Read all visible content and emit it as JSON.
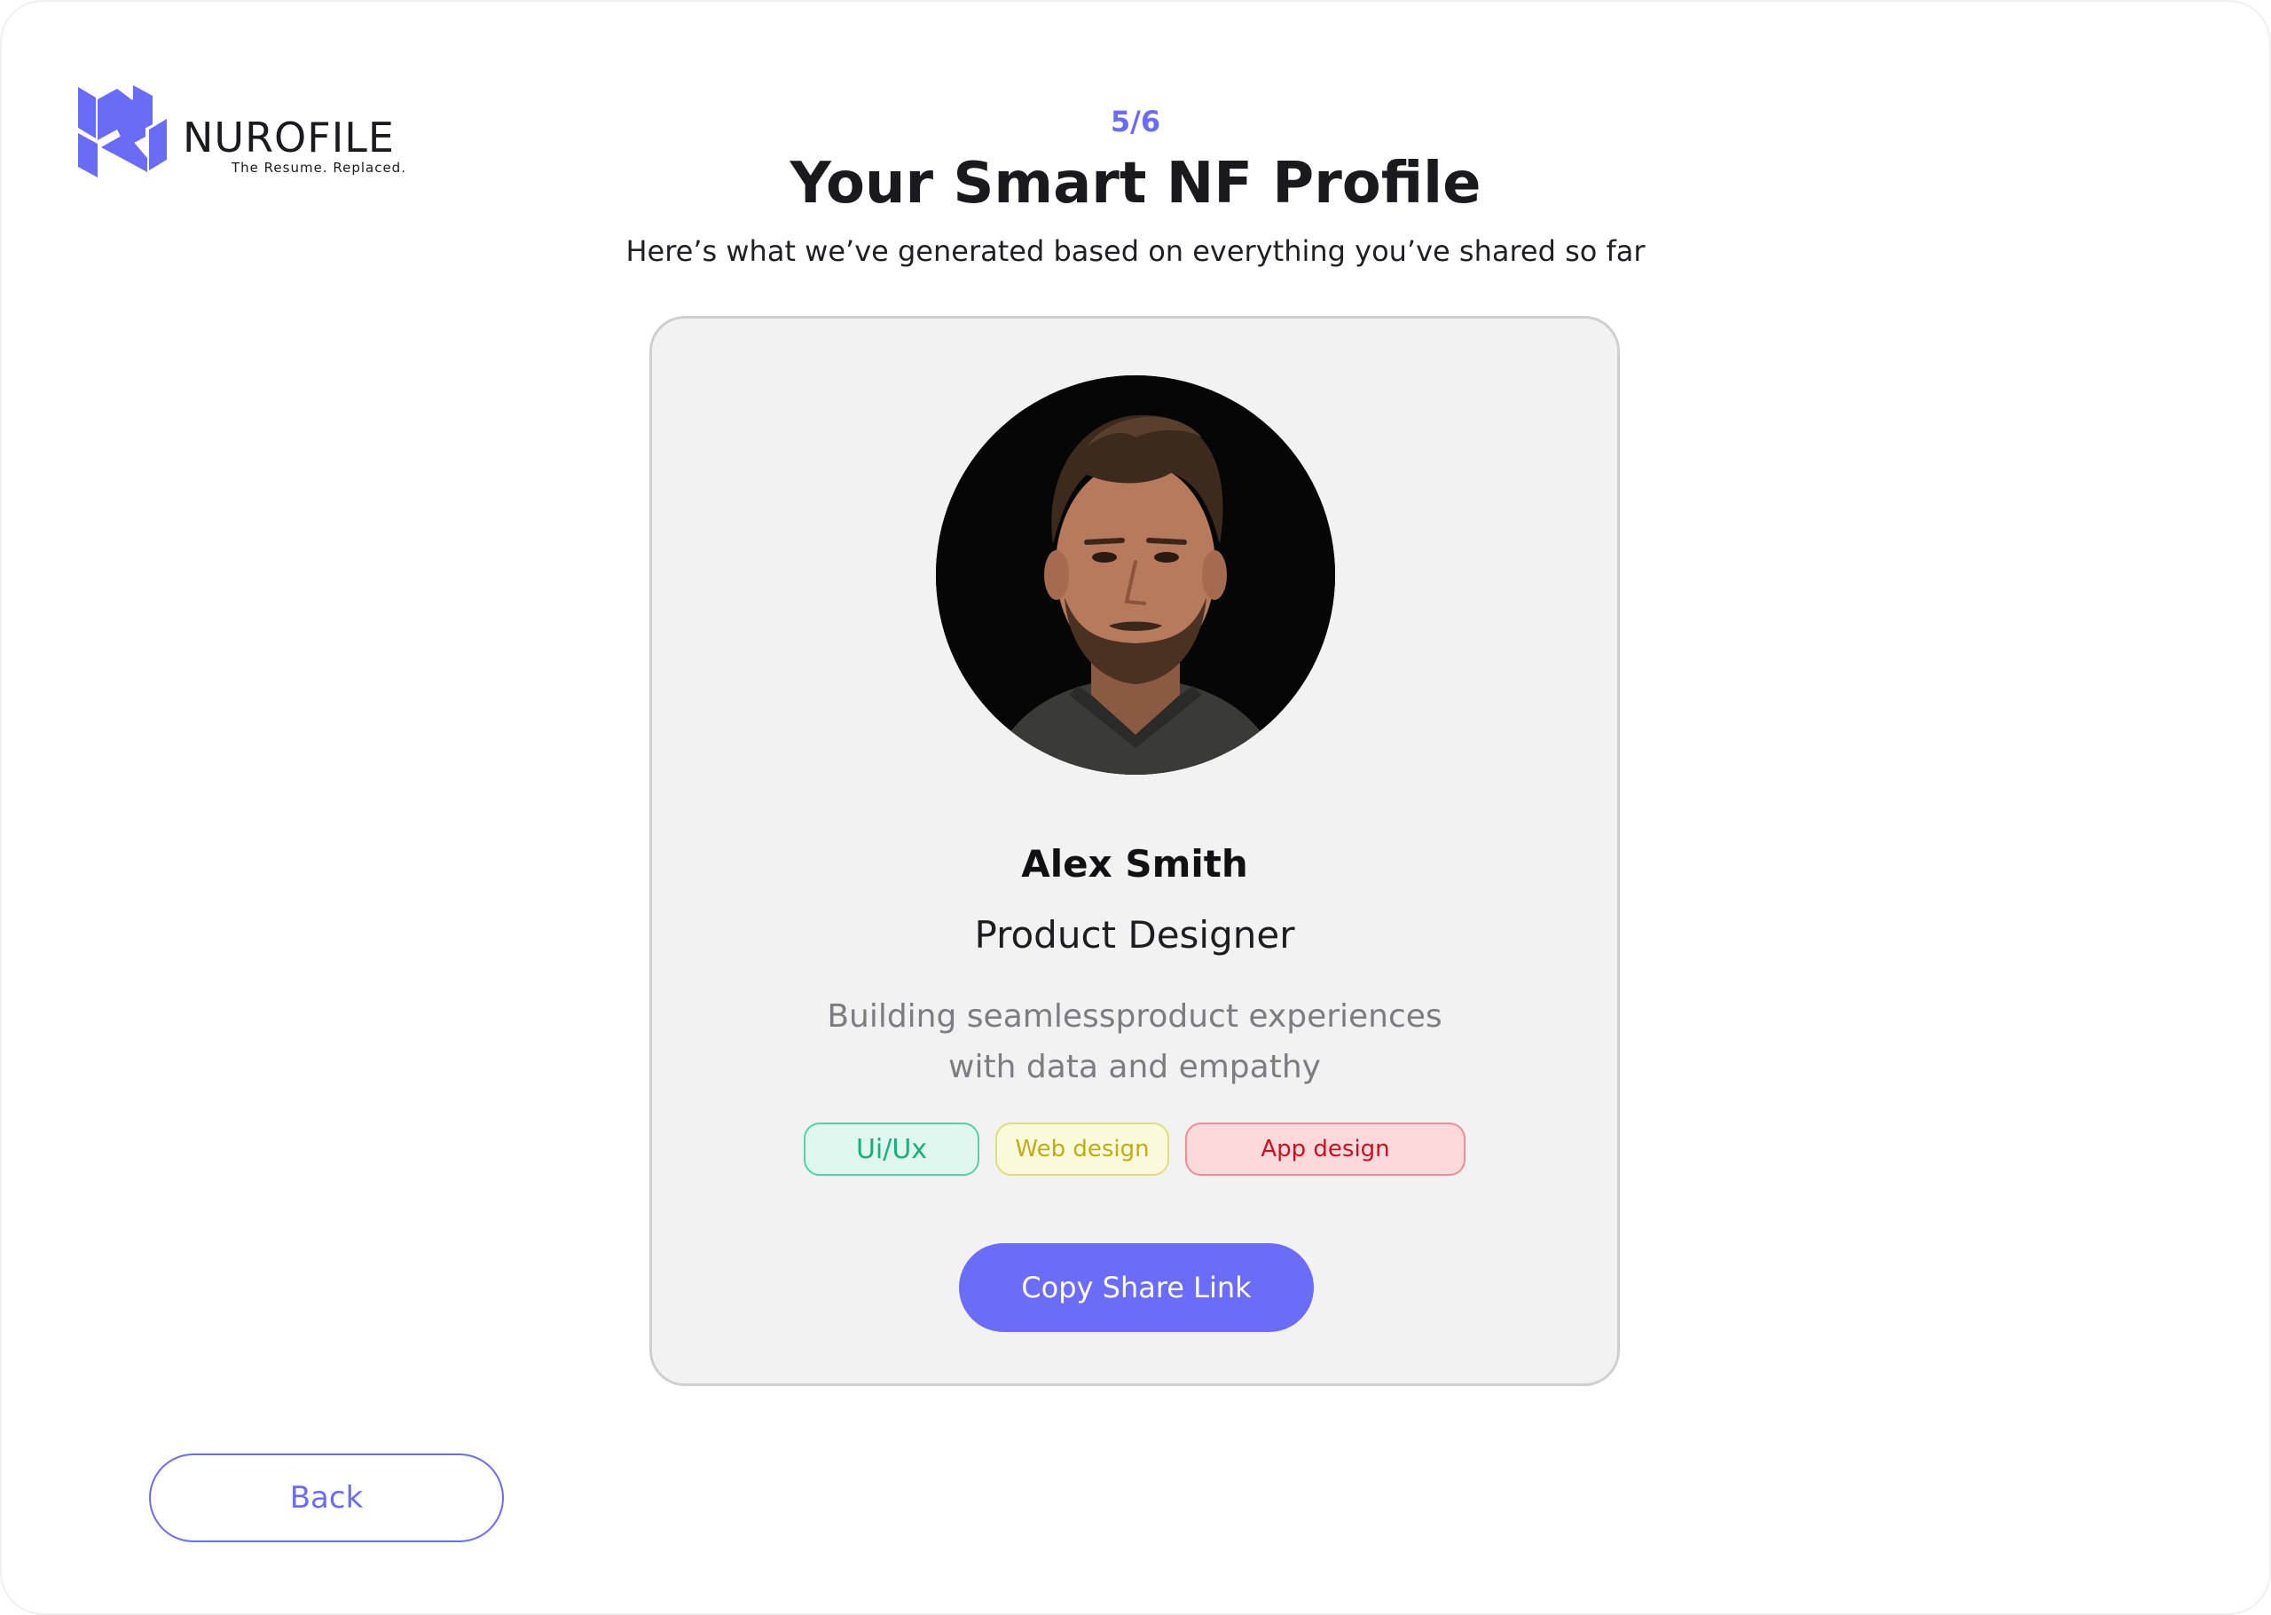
{
  "brand": {
    "name": "NUROFILE",
    "tagline": "The Resume. Replaced.",
    "accent_color": "#6b6cf6",
    "logo_icon": "nurofile-n-logo-icon"
  },
  "header": {
    "step": "5/6",
    "title": "Your Smart NF Profile",
    "subtitle": "Here’s what we’ve generated based on everything you’ve shared so far"
  },
  "profile": {
    "photo_icon": "profile-photo",
    "name": "Alex Smith",
    "role": "Product Designer",
    "bio": "Building seamlessproduct experiences with data and empathy",
    "tags": [
      {
        "label": "Ui/Ux",
        "color": "#18b07a"
      },
      {
        "label": "Web design",
        "color": "#bfae12"
      },
      {
        "label": "App design",
        "color": "#c8101f"
      }
    ],
    "share_button": "Copy Share Link"
  },
  "footer": {
    "back_button": "Back"
  }
}
